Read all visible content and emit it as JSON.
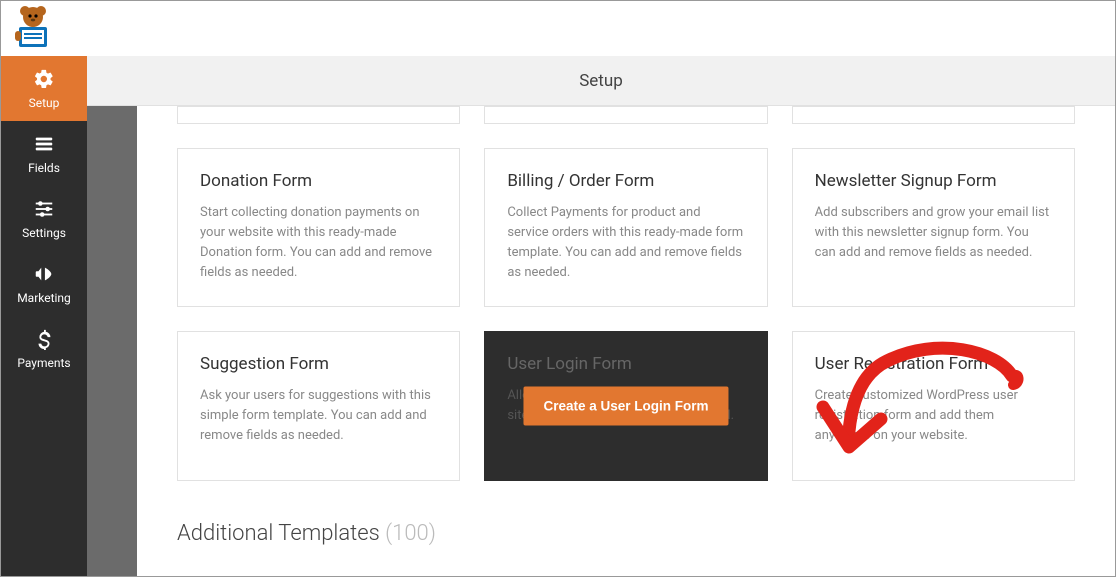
{
  "header": {
    "title": "Setup"
  },
  "sidebar": {
    "items": [
      {
        "label": "Setup"
      },
      {
        "label": "Fields"
      },
      {
        "label": "Settings"
      },
      {
        "label": "Marketing"
      },
      {
        "label": "Payments"
      }
    ]
  },
  "templates": {
    "row1": [
      {
        "title": "Donation Form",
        "desc": "Start collecting donation payments on your website with this ready-made Donation form. You can add and remove fields as needed."
      },
      {
        "title": "Billing / Order Form",
        "desc": "Collect Payments for product and service orders with this ready-made form template. You can add and remove fields as needed."
      },
      {
        "title": "Newsletter Signup Form",
        "desc": "Add subscribers and grow your email list with this newsletter signup form. You can add and remove fields as needed."
      }
    ],
    "row2": [
      {
        "title": "Suggestion Form",
        "desc": "Ask your users for suggestions with this simple form template. You can add and remove fields as needed."
      },
      {
        "title": "User Login Form",
        "desc": "Allow your users to easily login to your site with their username and password.",
        "button": "Create a User Login Form"
      },
      {
        "title": "User Registration Form",
        "desc": "Create customized WordPress user registration form and add them anywhere on your website."
      }
    ]
  },
  "section": {
    "title": "Additional Templates ",
    "count": "(100)"
  }
}
